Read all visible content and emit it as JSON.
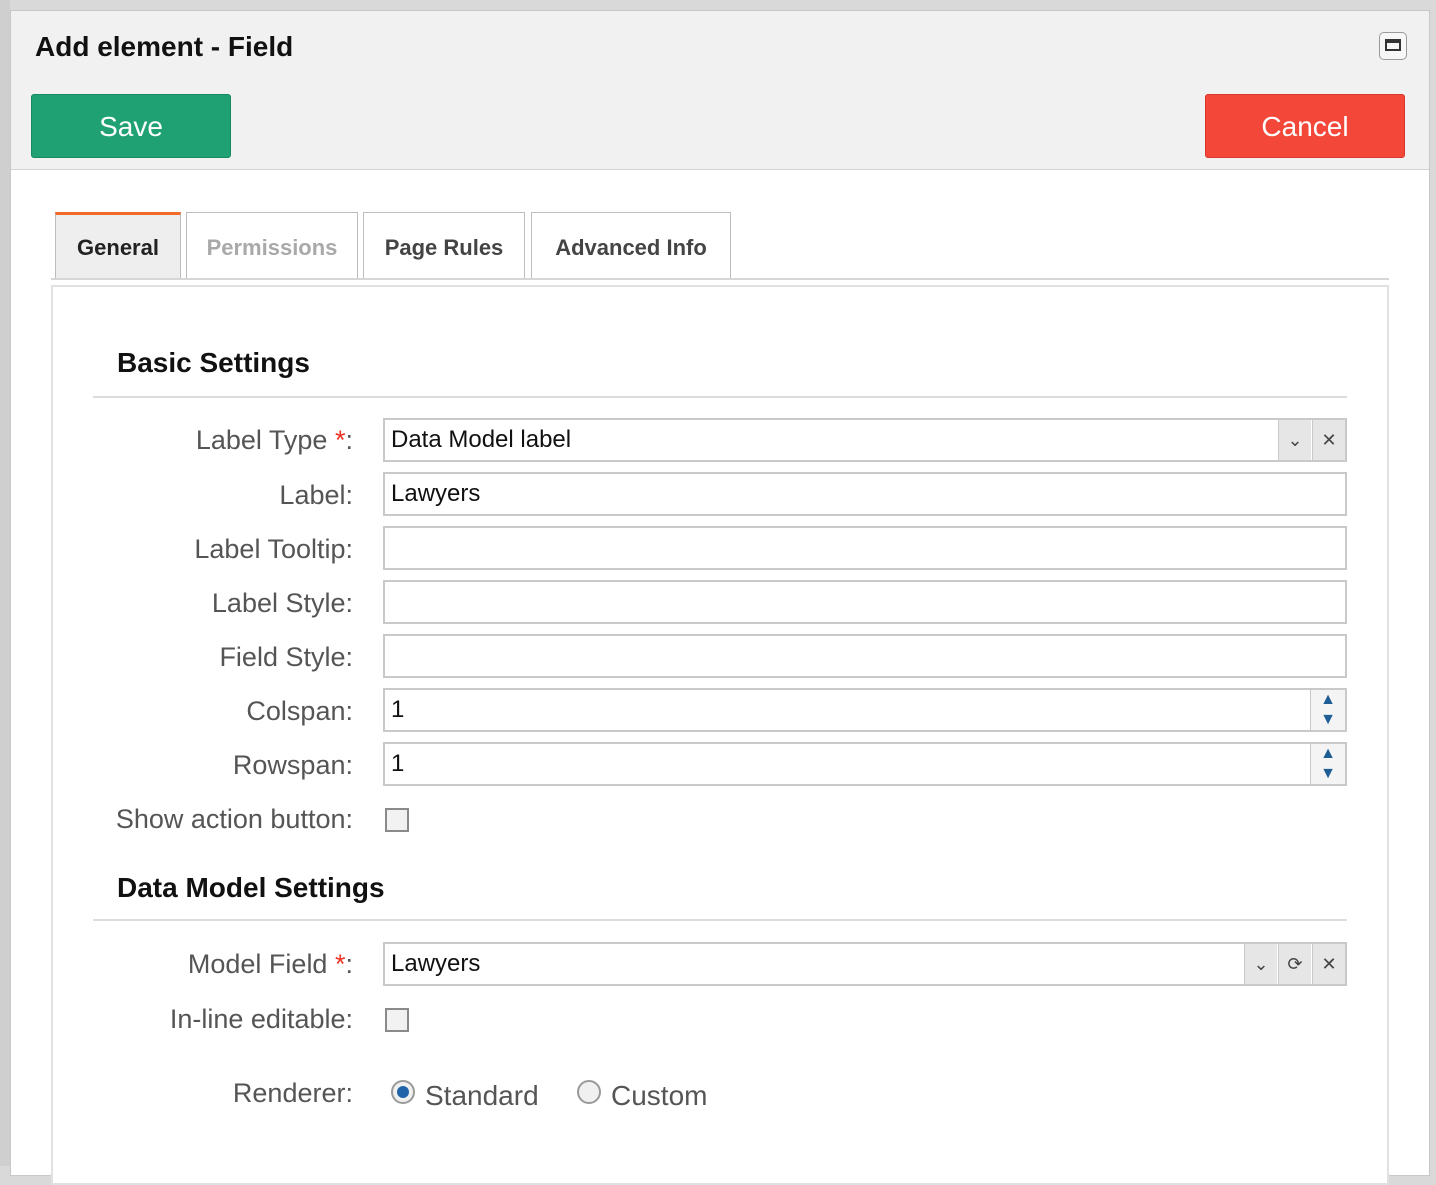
{
  "dialog": {
    "title": "Add element - Field",
    "save_label": "Save",
    "cancel_label": "Cancel"
  },
  "tabs": [
    {
      "label": "General",
      "state": "active"
    },
    {
      "label": "Permissions",
      "state": "disabled"
    },
    {
      "label": "Page Rules",
      "state": "normal"
    },
    {
      "label": "Advanced Info",
      "state": "normal"
    }
  ],
  "basic": {
    "title": "Basic Settings",
    "label_type": {
      "label": "Label Type",
      "required_mark": "*",
      "suffix": ":",
      "value": "Data Model label"
    },
    "label": {
      "label": "Label:",
      "value": "Lawyers"
    },
    "label_tooltip": {
      "label": "Label Tooltip:",
      "value": ""
    },
    "label_style": {
      "label": "Label Style:",
      "value": ""
    },
    "field_style": {
      "label": "Field Style:",
      "value": ""
    },
    "colspan": {
      "label": "Colspan:",
      "value": "1"
    },
    "rowspan": {
      "label": "Rowspan:",
      "value": "1"
    },
    "show_action_button": {
      "label": "Show action button:",
      "checked": false
    }
  },
  "data_model": {
    "title": "Data Model Settings",
    "model_field": {
      "label": "Model Field",
      "required_mark": "*",
      "suffix": ":",
      "value": "Lawyers"
    },
    "inline_editable": {
      "label": "In-line editable:",
      "checked": false
    },
    "renderer": {
      "label": "Renderer:",
      "options": [
        "Standard",
        "Custom"
      ],
      "selected": "Standard"
    }
  },
  "colors": {
    "save": "#1fa174",
    "cancel": "#f3473a",
    "active_tab": "#f26a2a",
    "required": "#e32"
  }
}
